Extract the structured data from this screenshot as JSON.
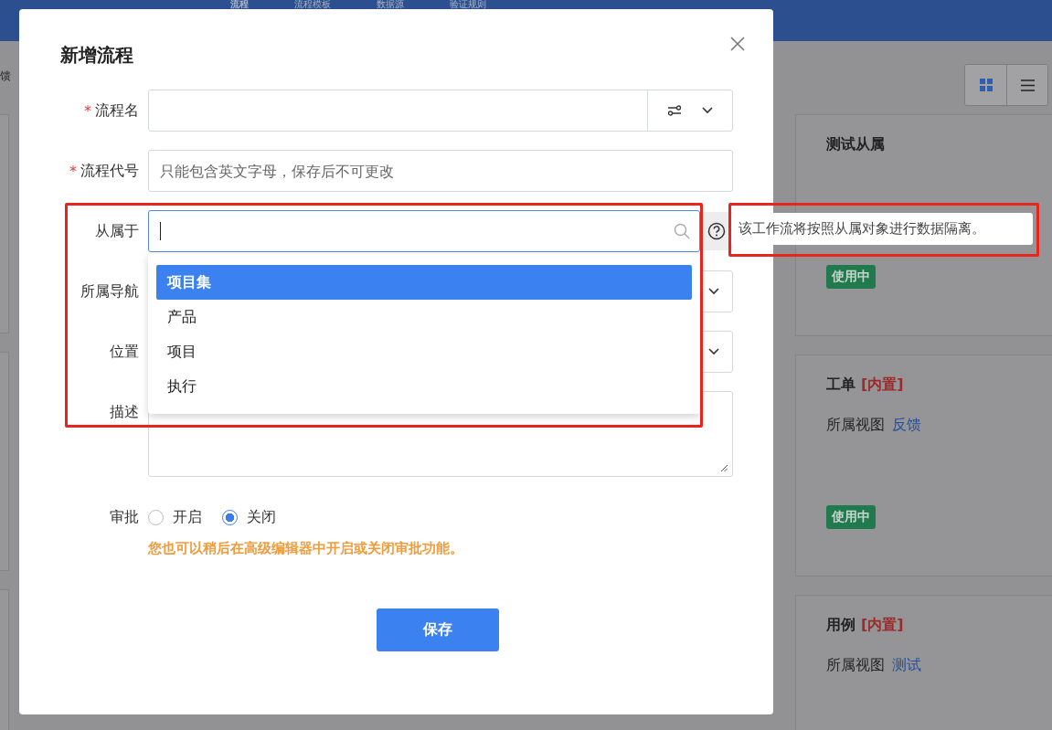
{
  "header": {
    "tabs": [
      {
        "label": "流程",
        "selected": true
      },
      {
        "label": "流程模板",
        "selected": false
      },
      {
        "label": "数据源",
        "selected": false
      },
      {
        "label": "验证规则",
        "selected": false
      }
    ]
  },
  "toolbar": {
    "left_text": "馈",
    "views": [
      {
        "kind": "grid",
        "selected": true
      },
      {
        "kind": "list",
        "selected": false
      }
    ]
  },
  "cards": [
    {
      "title": "测试从属",
      "status": "使用中"
    },
    {
      "title": "工单",
      "tag": "[内置]",
      "view_label": "所属视图",
      "view": "反馈",
      "status": "使用中"
    },
    {
      "title": "用例",
      "tag": "[内置]",
      "view_label": "所属视图",
      "view": "测试"
    }
  ],
  "dialog": {
    "title": "新增流程",
    "fields": [
      {
        "kind": "name",
        "label": "流程名",
        "required_mark": "*"
      },
      {
        "kind": "text",
        "label": "流程代号",
        "required_mark": "*",
        "placeholder": "只能包含英文字母，保存后不可更改"
      },
      {
        "kind": "search",
        "label": "从属于"
      },
      {
        "kind": "select",
        "label": "所属导航"
      },
      {
        "kind": "select",
        "label": "位置"
      },
      {
        "kind": "textarea",
        "label": "描述"
      }
    ],
    "dropdown": [
      {
        "label": "项目集",
        "selected": true
      },
      {
        "label": "产品",
        "selected": false
      },
      {
        "label": "项目",
        "selected": false
      },
      {
        "label": "执行",
        "selected": false
      }
    ],
    "tooltip": "该工作流将按照从属对象进行数据隔离。",
    "approval": {
      "label": "审批",
      "options": [
        {
          "label": "开启",
          "selected": false
        },
        {
          "label": "关闭",
          "selected": true
        }
      ],
      "hint": "您也可以稍后在高级编辑器中开启或关闭审批功能。"
    },
    "save_button": "保存"
  }
}
